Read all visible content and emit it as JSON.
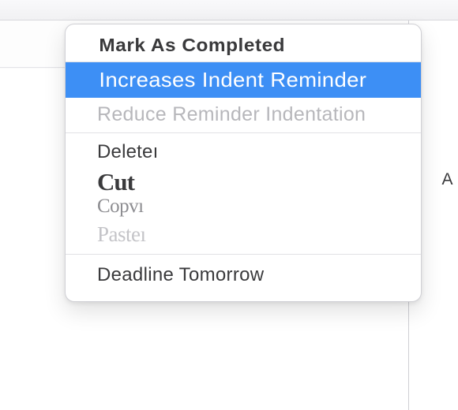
{
  "toolbar": {},
  "right_panel": {
    "label": "A"
  },
  "context_menu": {
    "items": {
      "complete": {
        "label": "Mark As Completed"
      },
      "increase": {
        "label": "Increases Indent Reminder"
      },
      "reduce": {
        "label": "Reduce Reminder Indentation"
      },
      "delete": {
        "label": "Deleteı"
      },
      "cut": {
        "label": "Cut"
      },
      "copy": {
        "label": "Copvı"
      },
      "paste": {
        "label": "Pasteı"
      },
      "deadline": {
        "label": "Deadline Tomorrow"
      }
    }
  }
}
